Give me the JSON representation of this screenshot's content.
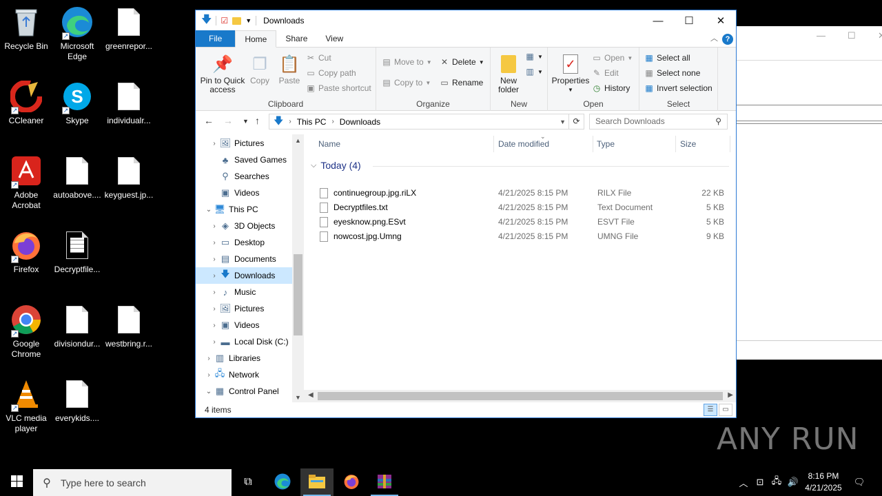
{
  "desktop": {
    "icons": [
      {
        "label": "Recycle Bin"
      },
      {
        "label": "Microsoft Edge"
      },
      {
        "label": "greenrepor..."
      },
      {
        "label": "CCleaner"
      },
      {
        "label": "Skype"
      },
      {
        "label": "individualr..."
      },
      {
        "label": "Adobe Acrobat"
      },
      {
        "label": "autoabove...."
      },
      {
        "label": "keyguest.jp..."
      },
      {
        "label": "Firefox"
      },
      {
        "label": "Decryptfile..."
      },
      {
        "label": "Google Chrome"
      },
      {
        "label": "divisiondur..."
      },
      {
        "label": "westbring.r..."
      },
      {
        "label": "VLC media player"
      },
      {
        "label": "everykids...."
      }
    ]
  },
  "explorer": {
    "title": "Downloads",
    "tabs": [
      "File",
      "Home",
      "Share",
      "View"
    ],
    "ribbon": {
      "clipboard": {
        "title": "Clipboard",
        "pin": "Pin to Quick access",
        "copy": "Copy",
        "paste": "Paste",
        "cut": "Cut",
        "copy_path": "Copy path",
        "paste_shortcut": "Paste shortcut"
      },
      "organize": {
        "title": "Organize",
        "move_to": "Move to",
        "copy_to": "Copy to",
        "delete": "Delete",
        "rename": "Rename"
      },
      "new": {
        "title": "New",
        "new_folder": "New folder"
      },
      "open": {
        "title": "Open",
        "properties": "Properties",
        "open": "Open",
        "edit": "Edit",
        "history": "History"
      },
      "select": {
        "title": "Select",
        "select_all": "Select all",
        "select_none": "Select none",
        "invert": "Invert selection"
      }
    },
    "address": {
      "crumbs": [
        "This PC",
        "Downloads"
      ],
      "search_placeholder": "Search Downloads"
    },
    "nav": [
      {
        "label": "Pictures",
        "level": 1,
        "icon": "pictures-icon"
      },
      {
        "label": "Saved Games",
        "level": 1,
        "icon": "saved-games-icon"
      },
      {
        "label": "Searches",
        "level": 1,
        "icon": "searches-icon"
      },
      {
        "label": "Videos",
        "level": 1,
        "icon": "videos-icon"
      },
      {
        "label": "This PC",
        "level": 0,
        "icon": "this-pc-icon"
      },
      {
        "label": "3D Objects",
        "level": 1,
        "icon": "3d-objects-icon"
      },
      {
        "label": "Desktop",
        "level": 1,
        "icon": "desktop-icon"
      },
      {
        "label": "Documents",
        "level": 1,
        "icon": "documents-icon"
      },
      {
        "label": "Downloads",
        "level": 1,
        "icon": "downloads-icon"
      },
      {
        "label": "Music",
        "level": 1,
        "icon": "music-icon"
      },
      {
        "label": "Pictures",
        "level": 1,
        "icon": "pictures-icon"
      },
      {
        "label": "Videos",
        "level": 1,
        "icon": "videos-icon"
      },
      {
        "label": "Local Disk (C:)",
        "level": 1,
        "icon": "local-disk-icon"
      },
      {
        "label": "Libraries",
        "level": 0,
        "icon": "libraries-icon"
      },
      {
        "label": "Network",
        "level": 0,
        "icon": "network-icon"
      },
      {
        "label": "Control Panel",
        "level": 0,
        "icon": "control-panel-icon"
      }
    ],
    "columns": [
      "Name",
      "Date modified",
      "Type",
      "Size"
    ],
    "group_label": "Today (4)",
    "files": [
      {
        "name": "continuegroup.jpg.riLX",
        "date": "4/21/2025 8:15 PM",
        "type": "RILX File",
        "size": "22 KB"
      },
      {
        "name": "Decryptfiles.txt",
        "date": "4/21/2025 8:15 PM",
        "type": "Text Document",
        "size": "5 KB"
      },
      {
        "name": "eyesknow.png.ESvt",
        "date": "4/21/2025 8:15 PM",
        "type": "ESVT File",
        "size": "5 KB"
      },
      {
        "name": "nowcost.jpg.Umng",
        "date": "4/21/2025 8:15 PM",
        "type": "UMNG File",
        "size": "9 KB"
      }
    ],
    "status": "4 items"
  },
  "watermark": "ANY RUN",
  "taskbar": {
    "search_placeholder": "Type here to search",
    "time": "8:16 PM",
    "date": "4/21/2025"
  },
  "colors": {
    "accent": "#1979ca",
    "selection": "#cce8ff"
  }
}
